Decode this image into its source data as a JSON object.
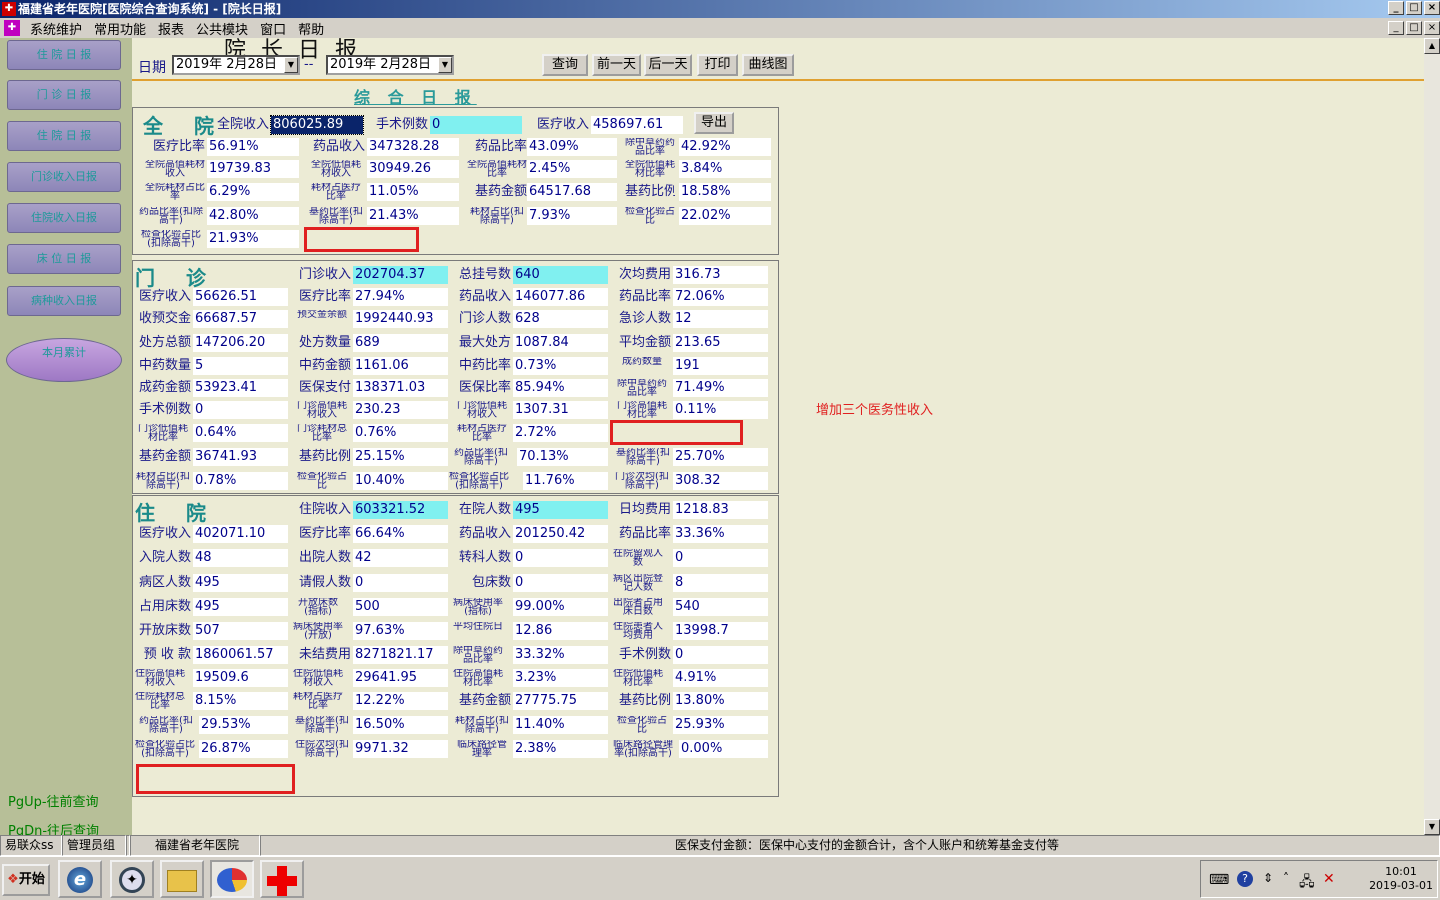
{
  "window": {
    "title": "福建省老年医院[医院综合查询系统] - [院长日报]",
    "btn_min": "_",
    "btn_max": "□",
    "btn_close": "×"
  },
  "menu": [
    "系统维护",
    "常用功能",
    "报表",
    "公共模块",
    "窗口",
    "帮助"
  ],
  "sidebar": {
    "buttons": [
      "住 院 日 报",
      "门 诊 日 报",
      "住 院 日 报",
      "门诊收入日报",
      "住院收入日报",
      "床 位 日 报",
      "病种收入日报"
    ],
    "oval_button": "本月累计",
    "hint_up": "PgUp-往前查询",
    "hint_down": "PgDn-往后查询"
  },
  "header": {
    "big_title": "院 长 日 报",
    "date_label": "日期",
    "date_from": "2019年  2月28日",
    "date_sep": "--",
    "date_to": "2019年  2月28日",
    "buttons": [
      "查询",
      "前一天",
      "后一天",
      "打印",
      "曲线图"
    ]
  },
  "report_title": "综 合 日 报",
  "whole": {
    "title": "全 院",
    "export": "导出",
    "fields": [
      {
        "label": "全院收入",
        "value": "806025.89",
        "style": "sel"
      },
      {
        "label": "手术例数",
        "value": "0",
        "style": "cy"
      },
      {
        "label": "医疗收入",
        "value": "458697.61"
      },
      {
        "label": "医疗比率",
        "value": "56.91%"
      },
      {
        "label": "药品收入",
        "value": "347328.28"
      },
      {
        "label": "药品比率",
        "value": "43.09%"
      },
      {
        "label": "除中草药药品比率",
        "value": "42.92%"
      },
      {
        "label": "全院高值耗材收入",
        "value": "19739.83"
      },
      {
        "label": "全院低值耗材收入",
        "value": "30949.26"
      },
      {
        "label": "全院高值耗材比率",
        "value": "2.45%"
      },
      {
        "label": "全院低值耗材比率",
        "value": "3.84%"
      },
      {
        "label": "全院耗材占比率",
        "value": "6.29%"
      },
      {
        "label": "耗材占医疗比率",
        "value": "11.05%"
      },
      {
        "label": "基药金额",
        "value": "64517.68"
      },
      {
        "label": "基药比例",
        "value": "18.58%"
      },
      {
        "label": "药品比率(扣除高干)",
        "value": "42.80%"
      },
      {
        "label": "基药比率(扣除高干)",
        "value": "21.43%"
      },
      {
        "label": "耗材占比(扣除高干)",
        "value": "7.93%"
      },
      {
        "label": "检查化验占比",
        "value": "22.02%"
      },
      {
        "label": "检查化验占比(扣除高干)",
        "value": "21.93%"
      }
    ]
  },
  "outpatient": {
    "title": "门 诊",
    "fields": [
      {
        "label": "门诊收入",
        "value": "202704.37",
        "style": "cy"
      },
      {
        "label": "总挂号数",
        "value": "640",
        "style": "cy"
      },
      {
        "label": "次均费用",
        "value": "316.73"
      },
      {
        "label": "医疗收入",
        "value": "56626.51"
      },
      {
        "label": "医疗比率",
        "value": "27.94%"
      },
      {
        "label": "药品收入",
        "value": "146077.86"
      },
      {
        "label": "药品比率",
        "value": "72.06%"
      },
      {
        "label": "收预交金",
        "value": "66687.57"
      },
      {
        "label": "预交金余额",
        "value": "1992440.93"
      },
      {
        "label": "门诊人数",
        "value": "628"
      },
      {
        "label": "急诊人数",
        "value": "12"
      },
      {
        "label": "处方总额",
        "value": "147206.20"
      },
      {
        "label": "处方数量",
        "value": "689"
      },
      {
        "label": "最大处方",
        "value": "1087.84"
      },
      {
        "label": "平均金额",
        "value": "213.65"
      },
      {
        "label": "中药数量",
        "value": "5"
      },
      {
        "label": "中药金额",
        "value": "1161.06"
      },
      {
        "label": "中药比率",
        "value": "0.73%"
      },
      {
        "label": "成药数量",
        "value": "191"
      },
      {
        "label": "成药金额",
        "value": "53923.41"
      },
      {
        "label": "医保支付",
        "value": "138371.03"
      },
      {
        "label": "医保比率",
        "value": "85.94%"
      },
      {
        "label": "除中草药药品比率",
        "value": "71.49%"
      },
      {
        "label": "手术例数",
        "value": "0"
      },
      {
        "label": "门诊高值耗材收入",
        "value": "230.23"
      },
      {
        "label": "门诊低值耗材收入",
        "value": "1307.31"
      },
      {
        "label": "门诊高值耗材比率",
        "value": "0.11%"
      },
      {
        "label": "门诊低值耗材比率",
        "value": "0.64%"
      },
      {
        "label": "门诊耗材总比率",
        "value": "0.76%"
      },
      {
        "label": "耗材占医疗比率",
        "value": "2.72%"
      },
      {
        "label": "基药金额",
        "value": "36741.93"
      },
      {
        "label": "基药比例",
        "value": "25.15%"
      },
      {
        "label": "药品比率(扣除高干)",
        "value": "70.13%"
      },
      {
        "label": "基药比率(扣除高干)",
        "value": "25.70%"
      },
      {
        "label": "耗材占比(扣除高干)",
        "value": "0.78%"
      },
      {
        "label": "检查化验占比",
        "value": "10.40%"
      },
      {
        "label": "检查化验占比(扣除高干)",
        "value": "11.76%"
      },
      {
        "label": "门诊次均(扣除高干)",
        "value": "308.32"
      }
    ]
  },
  "inpatient": {
    "title": "住 院",
    "fields": [
      {
        "label": "住院收入",
        "value": "603321.52",
        "style": "cy"
      },
      {
        "label": "在院人数",
        "value": "495",
        "style": "cy"
      },
      {
        "label": "日均费用",
        "value": "1218.83"
      },
      {
        "label": "医疗收入",
        "value": "402071.10"
      },
      {
        "label": "医疗比率",
        "value": "66.64%"
      },
      {
        "label": "药品收入",
        "value": "201250.42"
      },
      {
        "label": "药品比率",
        "value": "33.36%"
      },
      {
        "label": "入院人数",
        "value": "48"
      },
      {
        "label": "出院人数",
        "value": "42"
      },
      {
        "label": "转科人数",
        "value": "0"
      },
      {
        "label": "在院留观人数",
        "value": "0"
      },
      {
        "label": "病区人数",
        "value": "495"
      },
      {
        "label": "请假人数",
        "value": "0"
      },
      {
        "label": "包床数",
        "value": "0"
      },
      {
        "label": "病区出院登记人数",
        "value": "8"
      },
      {
        "label": "占用床数",
        "value": "495"
      },
      {
        "label": "开放床数(指标)",
        "value": "500"
      },
      {
        "label": "病床使用率(指标)",
        "value": "99.00%"
      },
      {
        "label": "出院者占用床日数",
        "value": "540"
      },
      {
        "label": "开放床数",
        "value": "507"
      },
      {
        "label": "病床使用率(开放)",
        "value": "97.63%"
      },
      {
        "label": "平均住院日",
        "value": "12.86"
      },
      {
        "label": "住院患者人均费用",
        "value": "13998.7"
      },
      {
        "label": "预 收 款",
        "value": "1860061.57"
      },
      {
        "label": "未结费用",
        "value": "8271821.17"
      },
      {
        "label": "除中草药药品比率",
        "value": "33.32%"
      },
      {
        "label": "手术例数",
        "value": "0"
      },
      {
        "label": "住院高值耗材收入",
        "value": "19509.6"
      },
      {
        "label": "住院低值耗材收入",
        "value": "29641.95"
      },
      {
        "label": "住院高值耗材比率",
        "value": "3.23%"
      },
      {
        "label": "住院低值耗材比率",
        "value": "4.91%"
      },
      {
        "label": "住院耗材总比率",
        "value": "8.15%"
      },
      {
        "label": "耗材占医疗比率",
        "value": "12.22%"
      },
      {
        "label": "基药金额",
        "value": "27775.75"
      },
      {
        "label": "基药比例",
        "value": "13.80%"
      },
      {
        "label": "药品比率(扣除高干)",
        "value": "29.53%"
      },
      {
        "label": "基药比率(扣除高干)",
        "value": "16.50%"
      },
      {
        "label": "耗材占比(扣除高干)",
        "value": "11.40%"
      },
      {
        "label": "检查化验占比",
        "value": "25.93%"
      },
      {
        "label": "检查化验占比(扣除高干)",
        "value": "26.87%"
      },
      {
        "label": "住院次均(扣除高干)",
        "value": "9971.32"
      },
      {
        "label": "临床路径管理率",
        "value": "2.38%"
      },
      {
        "label": "临床路径管理率(扣除高干)",
        "value": "0.00%"
      }
    ]
  },
  "annotation": "增加三个医务性收入",
  "statusbar": [
    "易联众ss",
    "管理员组",
    "福建省老年医院",
    "医保支付金额：医保中心支付的金额合计，含个人账户和统筹基金支付等"
  ],
  "taskbar": {
    "start": "开始",
    "time": "10:01",
    "date": "2019-03-01"
  }
}
